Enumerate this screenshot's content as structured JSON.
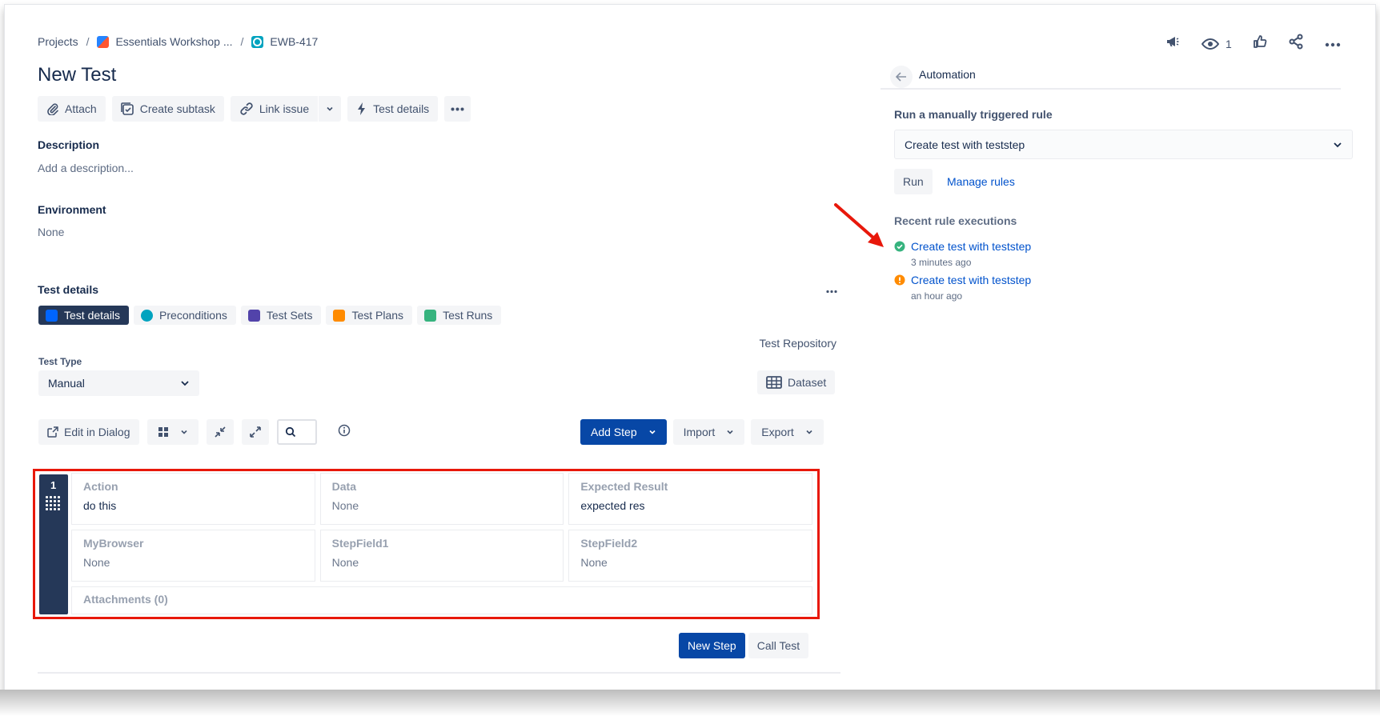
{
  "breadcrumb": {
    "projects": "Projects",
    "project": "Essentials Workshop ...",
    "issue_key": "EWB-417",
    "separator": "/"
  },
  "title": "New Test",
  "header_actions": {
    "watch_count": "1"
  },
  "toolbar": {
    "attach": "Attach",
    "create_subtask": "Create subtask",
    "link_issue": "Link issue",
    "test_details": "Test details"
  },
  "description": {
    "label": "Description",
    "placeholder": "Add a description..."
  },
  "environment": {
    "label": "Environment",
    "value": "None"
  },
  "test_details_section": {
    "label": "Test details",
    "tabs": [
      {
        "label": "Test details",
        "color": "#0065ff"
      },
      {
        "label": "Preconditions",
        "color": "#00a3bf"
      },
      {
        "label": "Test Sets",
        "color": "#5243aa"
      },
      {
        "label": "Test Plans",
        "color": "#ff8b00"
      },
      {
        "label": "Test Runs",
        "color": "#36b37e"
      }
    ],
    "repository_link": "Test Repository",
    "test_type_label": "Test Type",
    "test_type_value": "Manual",
    "dataset_button": "Dataset"
  },
  "steps_toolbar": {
    "edit_in_dialog": "Edit in Dialog",
    "add_step": "Add Step",
    "import": "Import",
    "export": "Export"
  },
  "step": {
    "number": "1",
    "fields": [
      {
        "label": "Action",
        "value": "do this"
      },
      {
        "label": "Data",
        "value": "None"
      },
      {
        "label": "Expected Result",
        "value": "expected res"
      },
      {
        "label": "MyBrowser",
        "value": "None"
      },
      {
        "label": "StepField1",
        "value": "None"
      },
      {
        "label": "StepField2",
        "value": "None"
      }
    ],
    "attachments": "Attachments (0)"
  },
  "step_actions": {
    "new_step": "New Step",
    "call_test": "Call Test"
  },
  "automation": {
    "title": "Automation",
    "run_label": "Run a manually triggered rule",
    "selected_rule": "Create test with teststep",
    "run_button": "Run",
    "manage_rules": "Manage rules",
    "recent_label": "Recent rule executions",
    "executions": [
      {
        "name": "Create test with teststep",
        "time": "3 minutes ago",
        "status": "success",
        "color": "#36b37e"
      },
      {
        "name": "Create test with teststep",
        "time": "an hour ago",
        "status": "warning",
        "color": "#ff8b00"
      }
    ]
  },
  "colors": {
    "primary": "#0747a6",
    "link": "#0052cc",
    "annotation": "#e8180b"
  }
}
